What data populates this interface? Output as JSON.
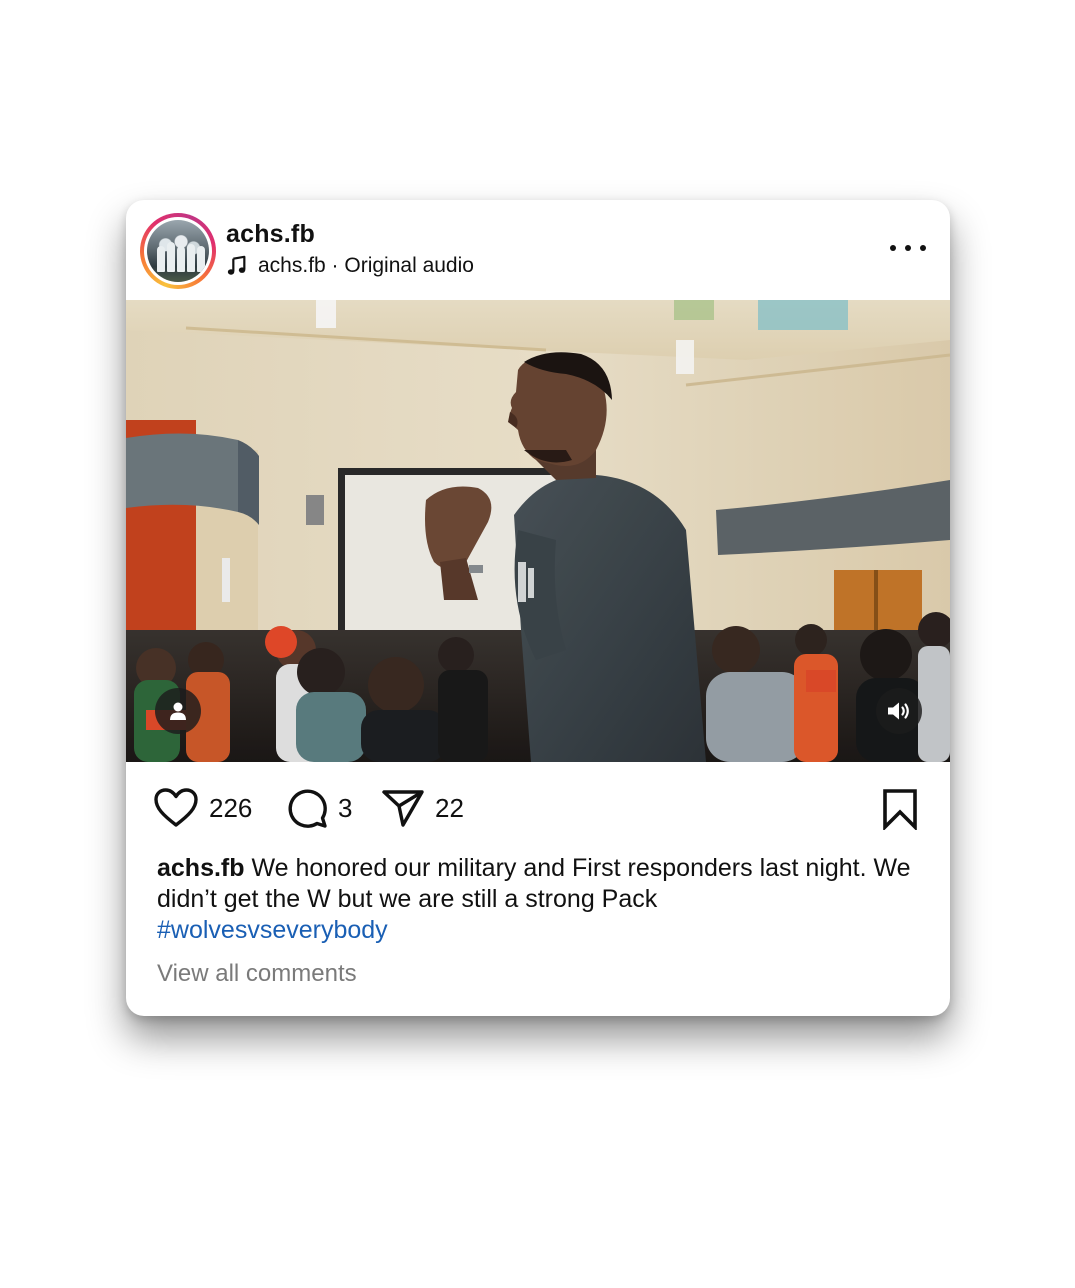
{
  "post": {
    "username": "achs.fb",
    "audio": "achs.fb · Original audio",
    "likes": "226",
    "comments": "3",
    "shares": "22",
    "caption_username": "achs.fb",
    "caption_text": " We honored our military and First responders last night.  We didn’t get the W but we are still  a strong Pack",
    "hashtag": "#wolvesvseverybody",
    "view_all": "View all comments"
  },
  "icons": {
    "audio": "music-note-icon",
    "more": "more-options-icon",
    "tagged": "tagged-people-icon",
    "volume": "volume-icon",
    "like": "heart-icon",
    "comment": "comment-bubble-icon",
    "share": "paper-plane-icon",
    "save": "bookmark-icon"
  },
  "colors": {
    "hashtag": "#1a5fb4",
    "story_ring_start": "#f9c23c",
    "story_ring_end": "#c13584",
    "muted_text": "#7a7a7a"
  }
}
